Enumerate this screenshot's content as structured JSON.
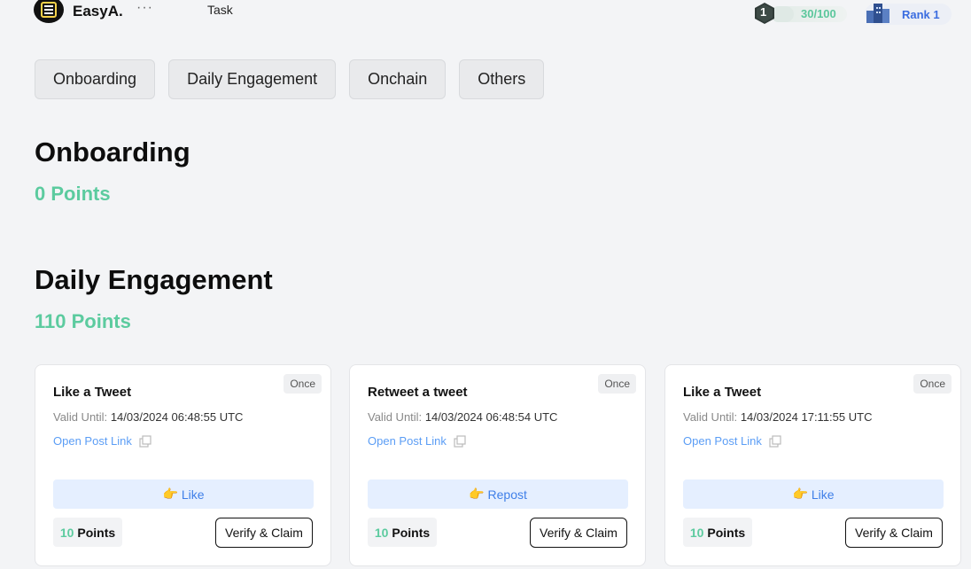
{
  "header": {
    "brand": "EasyA.",
    "more": "···",
    "nav_task": "Task",
    "level": {
      "number": "1",
      "progress_text": "30/100",
      "progress_fraction": 0.3
    },
    "rank": "Rank 1"
  },
  "tabs": [
    "Onboarding",
    "Daily Engagement",
    "Onchain",
    "Others"
  ],
  "sections": [
    {
      "title": "Onboarding",
      "points": "0 Points"
    },
    {
      "title": "Daily Engagement",
      "points": "110 Points"
    }
  ],
  "cards": [
    {
      "badge": "Once",
      "title": "Like a Tweet",
      "valid_label": "Valid Until:",
      "valid_value": "14/03/2024 06:48:55 UTC",
      "link": "Open Post Link",
      "action_emoji": "👉",
      "action": "Like",
      "points_num": "10",
      "points_label": "Points",
      "verify": "Verify & Claim"
    },
    {
      "badge": "Once",
      "title": "Retweet a tweet",
      "valid_label": "Valid Until:",
      "valid_value": "14/03/2024 06:48:54 UTC",
      "link": "Open Post Link",
      "action_emoji": "👉",
      "action": "Repost",
      "points_num": "10",
      "points_label": "Points",
      "verify": "Verify & Claim"
    },
    {
      "badge": "Once",
      "title": "Like a Tweet",
      "valid_label": "Valid Until:",
      "valid_value": "14/03/2024 17:11:55 UTC",
      "link": "Open Post Link",
      "action_emoji": "👉",
      "action": "Like",
      "points_num": "10",
      "points_label": "Points",
      "verify": "Verify & Claim"
    }
  ],
  "icons": {
    "logo": "easya-logo-icon",
    "link": "external-link-icon",
    "level": "hexagon-level-icon",
    "rank": "building-rank-icon"
  },
  "colors": {
    "accent_green": "#5ccb9f",
    "link_blue": "#5b9df5",
    "rank_blue": "#3b6de0",
    "action_bg": "#e5efff"
  }
}
